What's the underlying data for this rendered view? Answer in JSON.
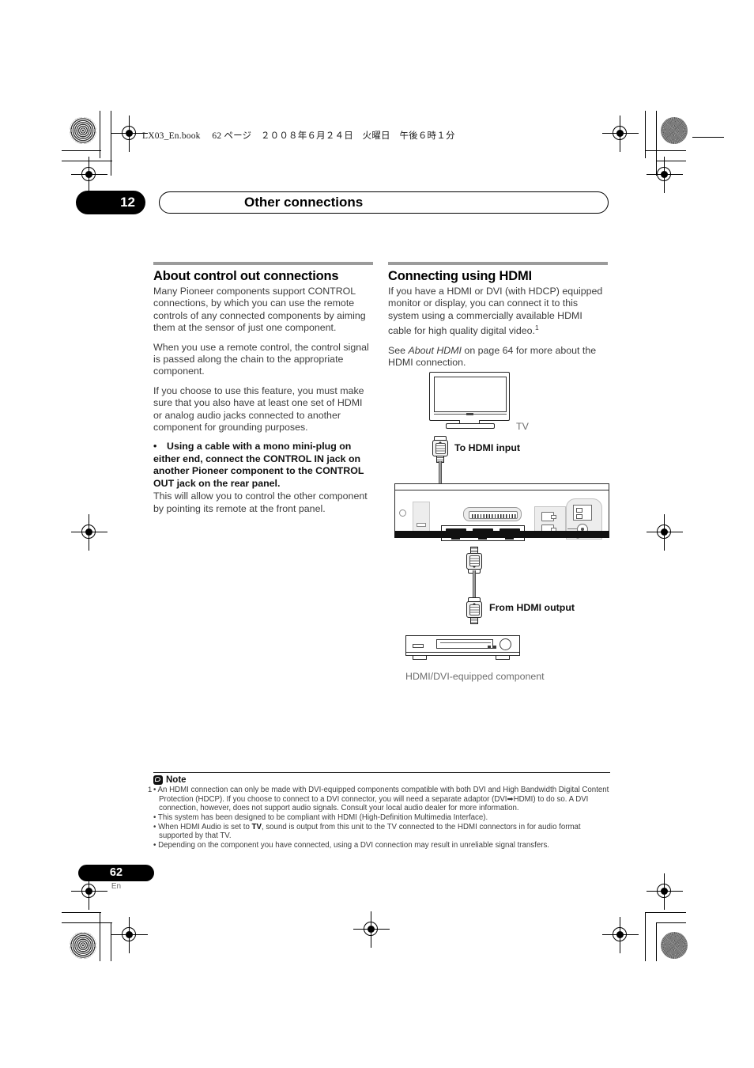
{
  "print_marks": {
    "book_header": "LX03_En.book 　62 ページ　２００８年６月２４日　火曜日　午後６時１分"
  },
  "chapter": {
    "number": "12",
    "title": "Other connections"
  },
  "left_column": {
    "heading": "About control out connections",
    "paragraphs": [
      "Many Pioneer components support CONTROL connections, by which you can use the remote controls of any connected components by aiming them at the sensor of just one component.",
      "When you use a remote control, the control signal is passed along the chain to the appropriate component.",
      "If you choose to use this feature, you must make sure that you also have at least one set of HDMI or analog audio jacks connected to another component for grounding purposes."
    ],
    "bullet_bold": "Using a cable with a mono mini-plug on either end, connect the CONTROL IN jack on another Pioneer component to the CONTROL OUT jack on the rear panel.",
    "bullet_follow": "This will allow you to control the other component by pointing its remote at the front panel."
  },
  "right_column": {
    "heading": "Connecting using HDMI",
    "paragraph_1_a": "If you have a HDMI or DVI (with HDCP) equipped monitor or display, you can connect it to this system using a commercially available HDMI cable for high quality digital video.",
    "paragraph_1_footnote": "1",
    "paragraph_2_prefix": "See ",
    "paragraph_2_italic": "About HDMI",
    "paragraph_2_suffix": " on page 64 for more about the HDMI connection."
  },
  "diagram": {
    "tv_label": "TV",
    "to_hdmi_input": "To HDMI input",
    "from_hdmi_output": "From HDMI output",
    "component_label": "HDMI/DVI-equipped component"
  },
  "note": {
    "title": "Note",
    "marker": "1",
    "items": [
      "• An HDMI connection can only be made with DVI-equipped components compatible with both DVI and High Bandwidth Digital Content Protection (HDCP). If you choose to connect to a DVI connector, you will need a separate adaptor (DVI➡HDMI) to do so. A DVI connection, however, does not support audio signals. Consult your local audio dealer for more information.",
      "• This system has been designed to be compliant with HDMI (High-Definition Multimedia Interface).",
      "• Depending on the component you have connected, using a DVI connection may result in unreliable signal transfers."
    ],
    "item_hdmi_audio_prefix": "• When HDMI Audio is set to ",
    "item_hdmi_audio_bold": "TV",
    "item_hdmi_audio_suffix": ", sound is output from this unit to the TV connected to the HDMI connectors in for audio format supported by that TV."
  },
  "footer": {
    "page_number": "62",
    "language": "En"
  },
  "colors": {
    "body_text": "#3d3d3d",
    "heading": "#000000",
    "rule": "#9b9b9b",
    "accent_black": "#000000",
    "gray_label": "#6e6e6e"
  }
}
